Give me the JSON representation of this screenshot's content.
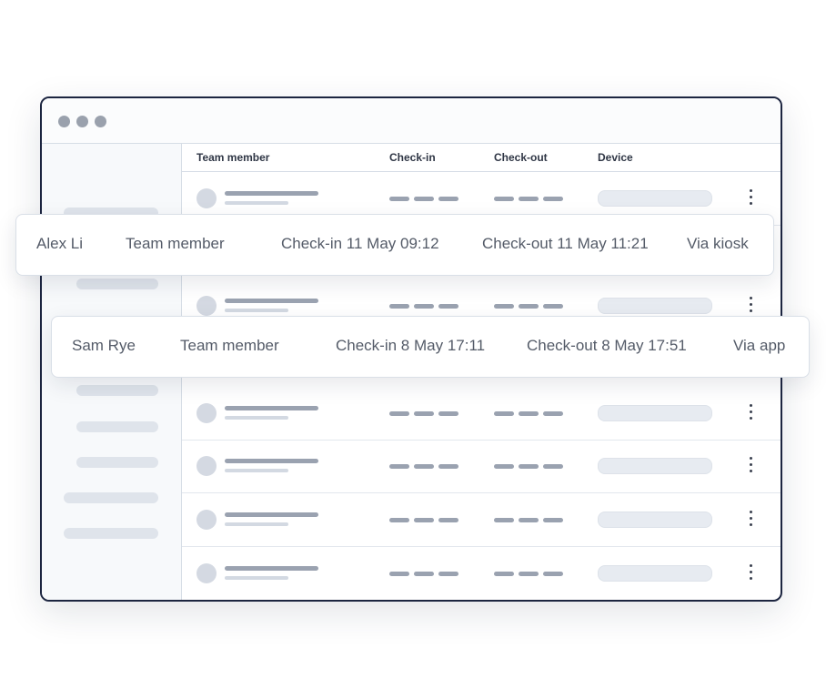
{
  "table": {
    "headers": {
      "member": "Team member",
      "checkin": "Check-in",
      "checkout": "Check-out",
      "device": "Device"
    }
  },
  "cards": [
    {
      "name": "Alex Li",
      "role": "Team member",
      "checkin": "Check-in 11 May 09:12",
      "checkout": "Check-out 11 May 11:21",
      "device": "Via kiosk"
    },
    {
      "name": "Sam Rye",
      "role": "Team member",
      "checkin": "Check-in 8 May 17:11",
      "checkout": "Check-out 8 May 17:51",
      "device": "Via app"
    }
  ],
  "icons": {
    "window_controls": "window-dots-icon",
    "row_menu": "more-vertical-icon"
  },
  "colors": {
    "window_border": "#1c2540",
    "placeholder": "#9aa2b0",
    "text": "#545b68"
  }
}
